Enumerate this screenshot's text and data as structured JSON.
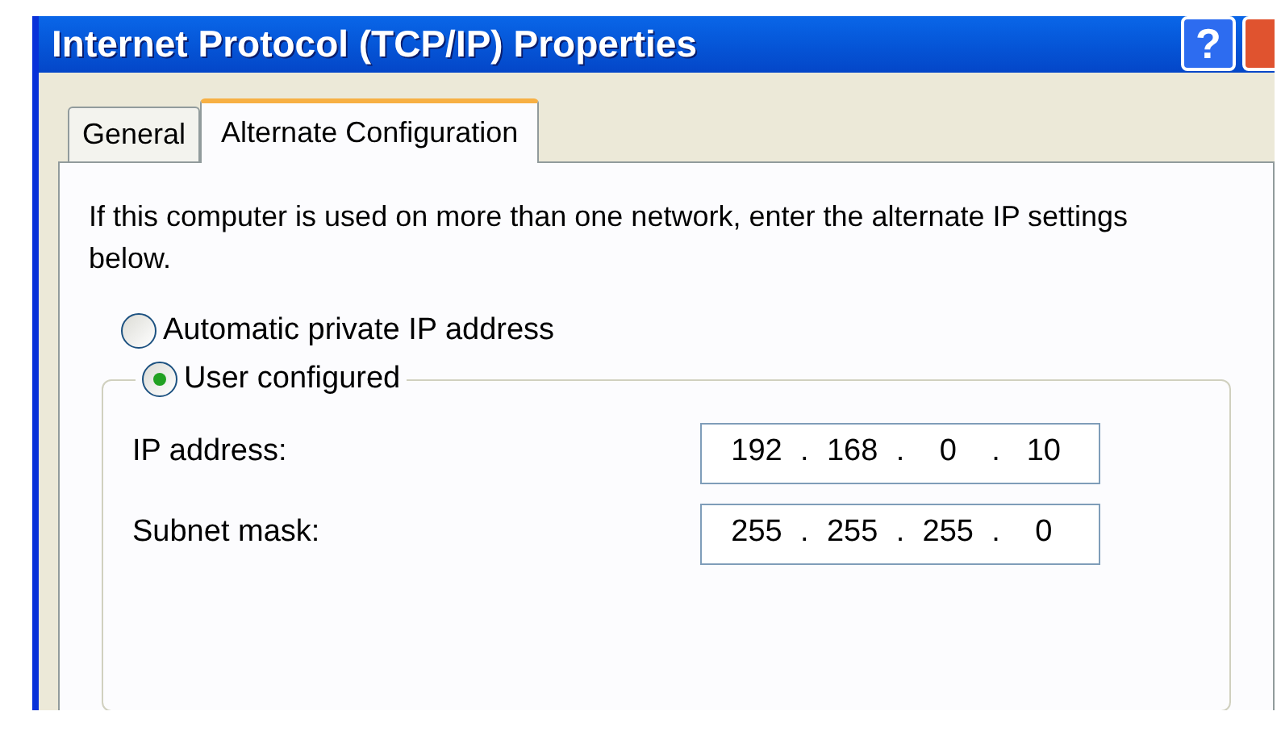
{
  "window": {
    "title": "Internet Protocol (TCP/IP) Properties",
    "buttons": [
      {
        "kind": "help",
        "label": "?"
      },
      {
        "kind": "close"
      }
    ]
  },
  "tabs": [
    {
      "label": "General",
      "selected": false
    },
    {
      "label": "Alternate Configuration",
      "selected": true
    }
  ],
  "description": "If this computer is used on more than one network, enter the alternate IP settings below.",
  "options": [
    {
      "label": "Automatic private IP address",
      "selected": false
    },
    {
      "label": "User configured",
      "selected": true
    }
  ],
  "fields": [
    {
      "label": "IP address:",
      "separator": ".",
      "octets": [
        "192",
        "168",
        "0",
        "10"
      ]
    },
    {
      "label": "Subnet mask:",
      "separator": ".",
      "octets": [
        "255",
        "255",
        "255",
        "0"
      ]
    }
  ]
}
